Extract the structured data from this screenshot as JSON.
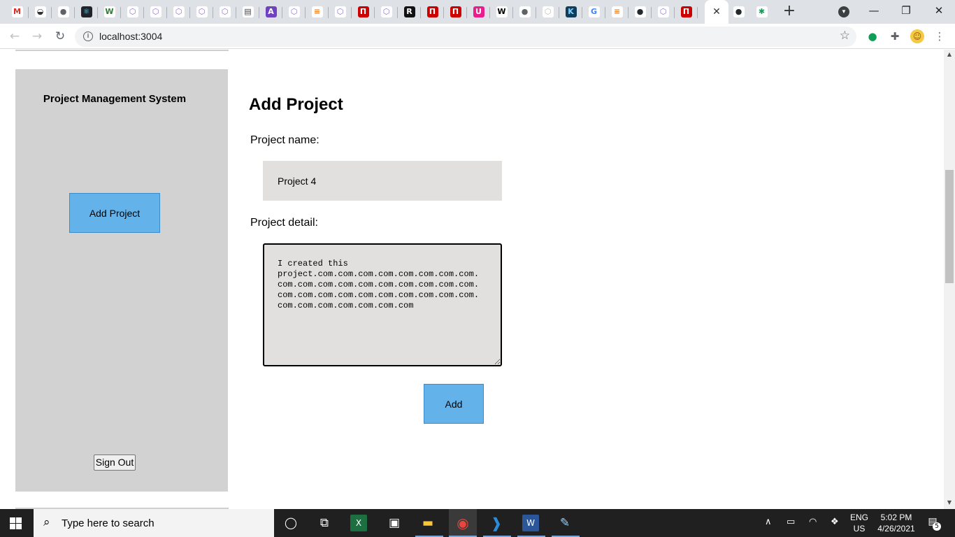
{
  "browser": {
    "tabs": [
      {
        "icon": "gmail-icon",
        "glyph": "M",
        "bg": "#ffffff",
        "fg": "#d93025"
      },
      {
        "icon": "incognito-icon",
        "glyph": "◒",
        "bg": "#ffffff",
        "fg": "#333333"
      },
      {
        "icon": "globe-icon",
        "glyph": "●",
        "bg": "#ffffff",
        "fg": "#5f6368"
      },
      {
        "icon": "react-icon",
        "glyph": "⚛",
        "bg": "#20232a",
        "fg": "#61dafb"
      },
      {
        "icon": "w-icon",
        "glyph": "W",
        "bg": "#ffffff",
        "fg": "#2e7d32"
      },
      {
        "icon": "graphql-icon",
        "glyph": "⬡",
        "bg": "#ffffff",
        "fg": "#8b6bd6"
      },
      {
        "icon": "graphql-icon",
        "glyph": "⬡",
        "bg": "#ffffff",
        "fg": "#8b6bd6"
      },
      {
        "icon": "graphql-icon",
        "glyph": "⬡",
        "bg": "#ffffff",
        "fg": "#8b6bd6"
      },
      {
        "icon": "graphql-icon",
        "glyph": "⬡",
        "bg": "#ffffff",
        "fg": "#8b6bd6"
      },
      {
        "icon": "graphql-icon",
        "glyph": "⬡",
        "bg": "#ffffff",
        "fg": "#8b6bd6"
      },
      {
        "icon": "doc-icon",
        "glyph": "▤",
        "bg": "#ffffff",
        "fg": "#444444"
      },
      {
        "icon": "apollo-icon",
        "glyph": "A",
        "bg": "#6f42c1",
        "fg": "#ffffff"
      },
      {
        "icon": "graphql-icon",
        "glyph": "⬡",
        "bg": "#ffffff",
        "fg": "#8b6bd6"
      },
      {
        "icon": "stackoverflow-icon",
        "glyph": "≡",
        "bg": "#ffffff",
        "fg": "#f48024"
      },
      {
        "icon": "graphql-icon",
        "glyph": "⬡",
        "bg": "#ffffff",
        "fg": "#8b6bd6"
      },
      {
        "icon": "netlify-icon",
        "glyph": "Π",
        "bg": "#cc0000",
        "fg": "#ffffff"
      },
      {
        "icon": "graphql-icon",
        "glyph": "⬡",
        "bg": "#ffffff",
        "fg": "#8b6bd6"
      },
      {
        "icon": "r-icon",
        "glyph": "R",
        "bg": "#111111",
        "fg": "#ffffff"
      },
      {
        "icon": "netlify-icon",
        "glyph": "Π",
        "bg": "#cc0000",
        "fg": "#ffffff"
      },
      {
        "icon": "netlify-icon",
        "glyph": "Π",
        "bg": "#cc0000",
        "fg": "#ffffff"
      },
      {
        "icon": "u-icon",
        "glyph": "U",
        "bg": "#e91e8c",
        "fg": "#ffffff"
      },
      {
        "icon": "wikipedia-icon",
        "glyph": "W",
        "bg": "#ffffff",
        "fg": "#000000"
      },
      {
        "icon": "globe-icon",
        "glyph": "●",
        "bg": "#ffffff",
        "fg": "#5f6368"
      },
      {
        "icon": "graphql-icon",
        "glyph": "⬡",
        "bg": "#ffffff",
        "fg": "#bbbbbb"
      },
      {
        "icon": "kb-icon",
        "glyph": "K",
        "bg": "#0f3d5e",
        "fg": "#7fd3ff"
      },
      {
        "icon": "google-icon",
        "glyph": "G",
        "bg": "#ffffff",
        "fg": "#4285f4"
      },
      {
        "icon": "stackoverflow-icon",
        "glyph": "≡",
        "bg": "#ffffff",
        "fg": "#f48024"
      },
      {
        "icon": "github-icon",
        "glyph": "●",
        "bg": "#ffffff",
        "fg": "#24292e"
      },
      {
        "icon": "graphql-icon",
        "glyph": "⬡",
        "bg": "#ffffff",
        "fg": "#8b6bd6"
      },
      {
        "icon": "netlify-icon",
        "glyph": "Π",
        "bg": "#cc0000",
        "fg": "#ffffff"
      }
    ],
    "tabs_after_active": [
      {
        "icon": "github-icon",
        "glyph": "●",
        "bg": "#ffffff",
        "fg": "#24292e"
      },
      {
        "icon": "chat-icon",
        "glyph": "✱",
        "bg": "#ffffff",
        "fg": "#0f9d58"
      }
    ],
    "active_tab_close": "✕",
    "new_tab": "+",
    "url": "localhost:3004",
    "window_buttons": {
      "minimize": "—",
      "restore": "❐",
      "close": "✕"
    }
  },
  "sidebar": {
    "title": "Project Management System",
    "add_project_label": "Add Project",
    "sign_out_label": "Sign Out"
  },
  "form": {
    "heading": "Add Project",
    "name_label": "Project name:",
    "name_value": "Project 4",
    "detail_label": "Project detail:",
    "detail_value": "I created this\nproject.com.com.com.com.com.com.com.com.\ncom.com.com.com.com.com.com.com.com.com.\ncom.com.com.com.com.com.com.com.com.com.\ncom.com.com.com.com.com.com",
    "submit_label": "Add"
  },
  "taskbar": {
    "search_placeholder": "Type here to search",
    "language_line1": "ENG",
    "language_line2": "US",
    "time": "5:02 PM",
    "date": "4/26/2021",
    "notification_count": "5",
    "apps": [
      "task-view-icon",
      "timeline-icon",
      "excel-icon",
      "store-icon",
      "file-explorer-icon",
      "chrome-icon",
      "vscode-icon",
      "word-icon",
      "paint-icon"
    ]
  },
  "colors": {
    "accent_button": "#63b3ea",
    "sidebar_bg": "#d1d2d1",
    "input_bg": "#e1e0df"
  }
}
